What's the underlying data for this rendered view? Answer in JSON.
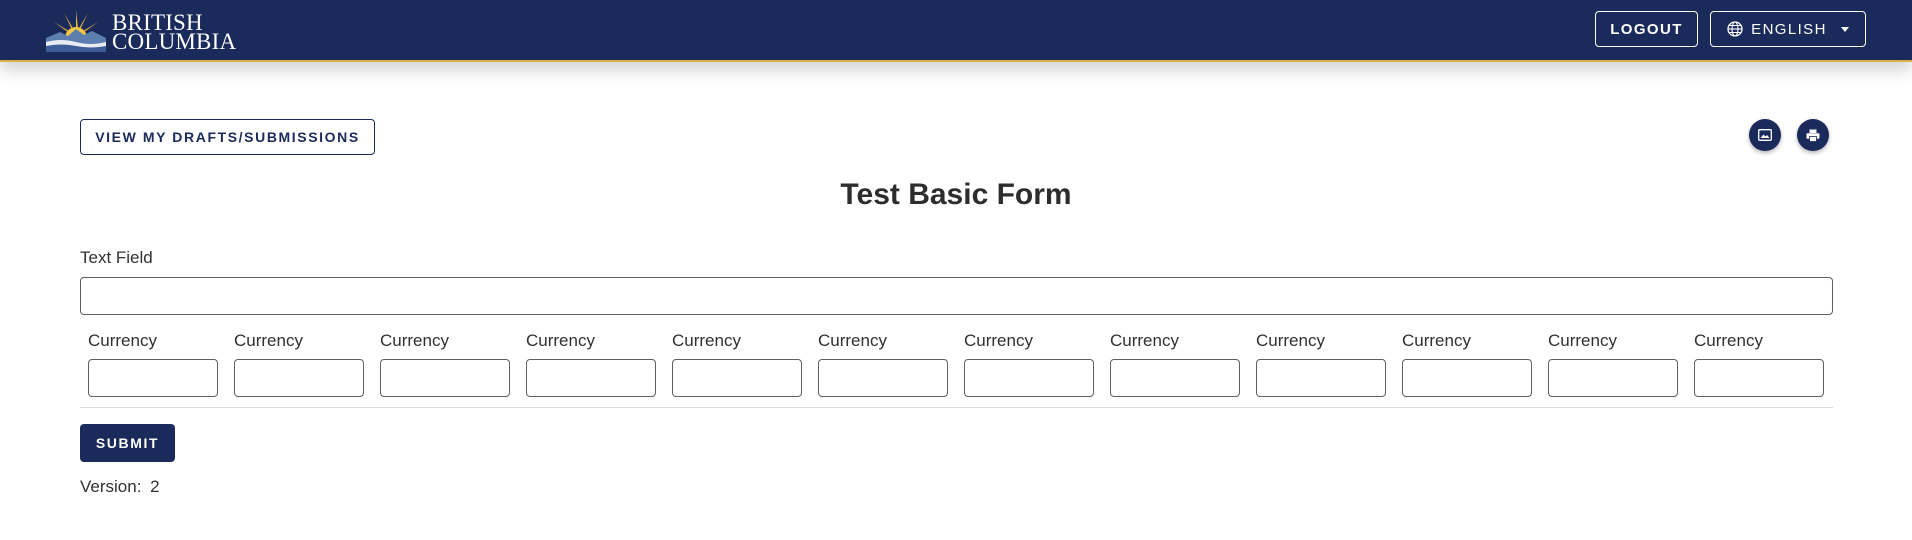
{
  "header": {
    "logo_alt": "British Columbia",
    "logo_line1": "BRITISH",
    "logo_line2": "COLUMBIA",
    "logout_label": "LOGOUT",
    "language_label": "ENGLISH"
  },
  "toolbar": {
    "drafts_label": "VIEW MY DRAFTS/SUBMISSIONS",
    "image_icon": "image-icon",
    "print_icon": "print-icon"
  },
  "form": {
    "title": "Test Basic Form",
    "text_field_label": "Text Field",
    "text_field_value": "",
    "currency_fields": [
      {
        "label": "Currency",
        "value": ""
      },
      {
        "label": "Currency",
        "value": ""
      },
      {
        "label": "Currency",
        "value": ""
      },
      {
        "label": "Currency",
        "value": ""
      },
      {
        "label": "Currency",
        "value": ""
      },
      {
        "label": "Currency",
        "value": ""
      },
      {
        "label": "Currency",
        "value": ""
      },
      {
        "label": "Currency",
        "value": ""
      },
      {
        "label": "Currency",
        "value": ""
      },
      {
        "label": "Currency",
        "value": ""
      },
      {
        "label": "Currency",
        "value": ""
      },
      {
        "label": "Currency",
        "value": ""
      }
    ],
    "submit_label": "SUBMIT",
    "version_label": "Version:",
    "version_value": "2"
  },
  "colors": {
    "brand_navy": "#1a2a5a",
    "brand_gold": "#d8b14a"
  }
}
